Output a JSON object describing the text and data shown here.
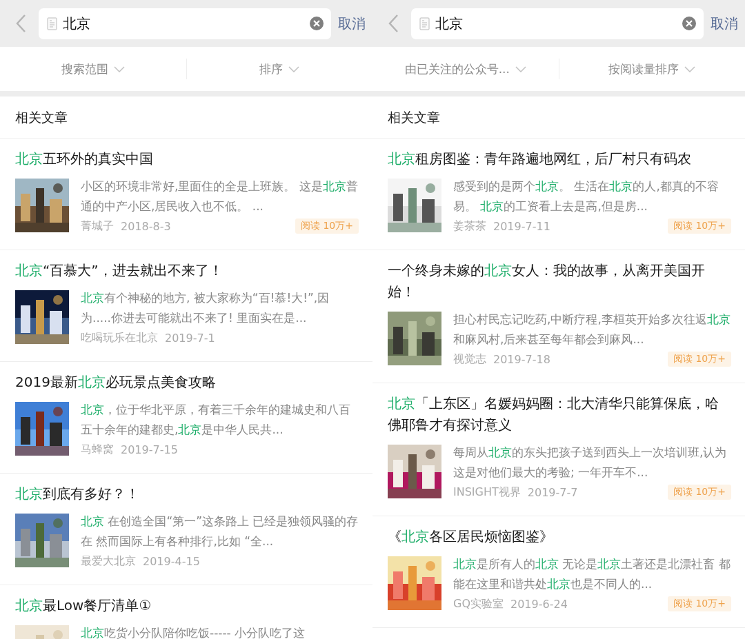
{
  "panels": [
    {
      "search": {
        "value": "北京"
      },
      "cancel": "取消",
      "filters": [
        {
          "label": "搜索范围"
        },
        {
          "label": "排序"
        }
      ],
      "section": "相关文章",
      "articles": [
        {
          "title": "**北京**五环外的真实中国",
          "snippet": "小区的环境非常好,里面住的全是上班族。 这是**北京**普通的中产小区,居民收入也不低。 ...",
          "source": "菁城子",
          "date": "2018-8-3",
          "badge": "阅读 10万+"
        },
        {
          "title": "**北京**“百慕大”，进去就出不来了！",
          "snippet": "**北京**有个神秘的地方, 被大家称为“百!慕!大!”,因为.....你进去可能就出不来了! 里面实在是...",
          "source": "吃喝玩乐在北京",
          "date": "2019-7-1"
        },
        {
          "title": "2019最新**北京**必玩景点美食攻略",
          "snippet": "**北京**，位于华北平原，有着三千余年的建城史和八百五十余年的建都史,**北京**是中华人民共...",
          "source": "马蜂窝",
          "date": "2019-7-15"
        },
        {
          "title": "**北京**到底有多好？！",
          "snippet": "**北京** 在创造全国“第一”这条路上 已经是独领风骚的存在 然而国际上有各种排行,比如 “全...",
          "source": "最爱大北京",
          "date": "2019-4-15"
        },
        {
          "title": "**北京**最Low餐厅清单①",
          "snippet": "**北京**吃货小分队陪你吃饭----- 小分队吃了这"
        }
      ]
    },
    {
      "search": {
        "value": "北京"
      },
      "cancel": "取消",
      "filters": [
        {
          "label": "由已关注的公众号..."
        },
        {
          "label": "按阅读量排序"
        }
      ],
      "section": "相关文章",
      "articles": [
        {
          "title": "**北京**租房图鉴：青年路遍地网红，后厂村只有码农",
          "snippet": "感受到的是两个**北京**。 生活在**北京**的人,都真的不容易。 **北京**的工资看上去是高,但是房...",
          "source": "姜茶茶",
          "date": "2019-7-11",
          "badge": "阅读 10万+"
        },
        {
          "title": "一个终身未嫁的**北京**女人：我的故事，从离开美国开始！",
          "snippet": "担心村民忘记吃药,中断疗程,李桓英开始多次往返**北京**和麻风村,后来甚至每年都会到麻风...",
          "source": "视觉志",
          "date": "2019-7-18",
          "badge": "阅读 10万+"
        },
        {
          "title": "**北京**「上东区」名媛妈妈圈：北大清华只能算保底，哈佛耶鲁才有探讨意义",
          "snippet": "每周从**北京**的东头把孩子送到西头上一次培训班,认为这是对他们最大的考验; 一年开车不...",
          "source": "INSIGHT视界",
          "date": "2019-7-7",
          "badge": "阅读 10万+"
        },
        {
          "title": "《**北京**各区居民烦恼图鉴》",
          "snippet": "**北京**是所有人的**北京** 无论是**北京**土著还是北漂社畜 都能在这里和谐共处**北京**也是不同人的...",
          "source": "GQ实验室",
          "date": "2019-6-24",
          "badge": "阅读 10万+"
        }
      ]
    }
  ]
}
